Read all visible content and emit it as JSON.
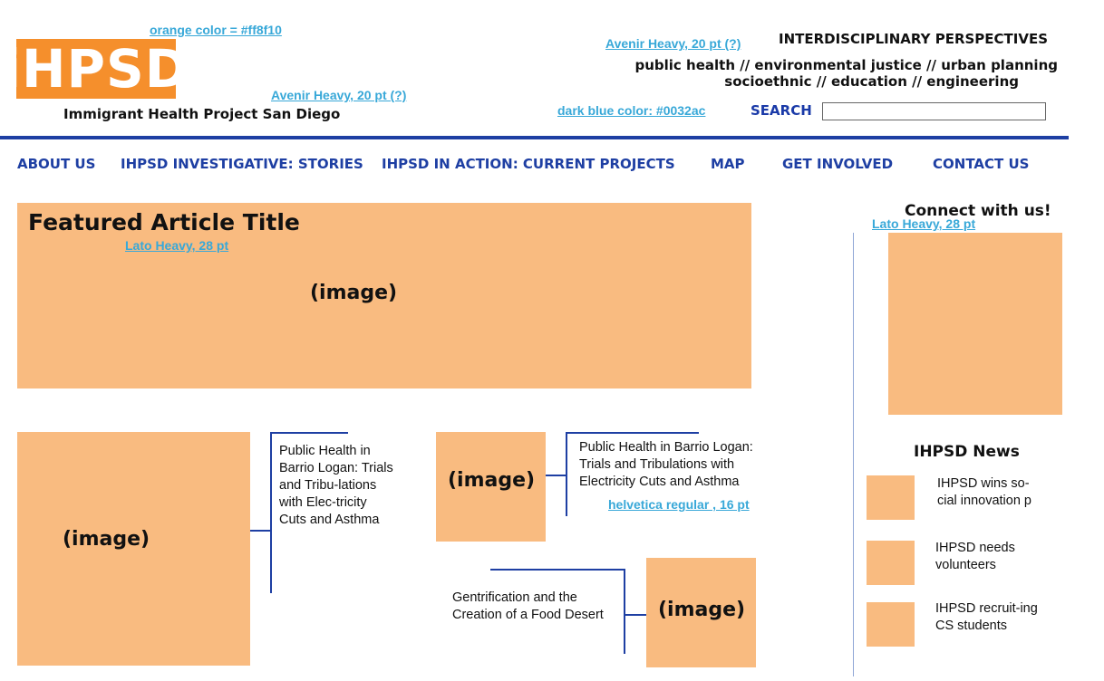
{
  "annotations": {
    "orange_color": "orange color =  #ff8f10",
    "font_tagline": "Avenir Heavy,  20 pt (?)",
    "font_header": "Avenir Heavy,  20 pt (?)",
    "dark_blue": "dark blue color:  #0032ac",
    "font_featured": "Lato Heavy,  28 pt",
    "font_connect": "Lato Heavy,  28 pt",
    "font_body": "helvetica regular , 16 pt"
  },
  "colors": {
    "orange": "#ff8f10",
    "dark_blue": "#0032ac",
    "placeholder": "#f9bb80"
  },
  "header": {
    "logo_text": "iHPSD",
    "tagline": "Immigrant Health Project San Diego",
    "perspectives_title": "INTERDISCIPLINARY PERSPECTIVES",
    "perspectives_line1": "public health // environmental justice // urban planning",
    "perspectives_line2": "socioethnic // education // engineering",
    "search_label": "SEARCH",
    "search_value": ""
  },
  "nav": [
    "ABOUT US",
    "IHPSD INVESTIGATIVE: STORIES",
    "IHPSD IN ACTION: CURRENT PROJECTS",
    "MAP",
    "GET INVOLVED",
    "CONTACT US"
  ],
  "featured": {
    "title": "Featured Article Title",
    "image_label": "(image)"
  },
  "articles": [
    {
      "image_label": "(image)",
      "text": "Public Health in Barrio Logan: Trials and Tribu-lations with Elec-tricity Cuts and Asthma"
    },
    {
      "image_label": "(image)",
      "text": "Public Health in Barrio Logan: Trials and Tribulations with Electricity Cuts and Asthma"
    },
    {
      "image_label": "(image)",
      "text": "Gentrification and the Creation of a Food Desert"
    }
  ],
  "sidebar": {
    "connect_title": "Connect with us!",
    "news_title": "IHPSD News",
    "news": [
      {
        "text": "IHPSD wins so-cial innovation p"
      },
      {
        "text": "IHPSD needs volunteers"
      },
      {
        "text": "IHPSD recruit-ing CS students"
      }
    ]
  }
}
